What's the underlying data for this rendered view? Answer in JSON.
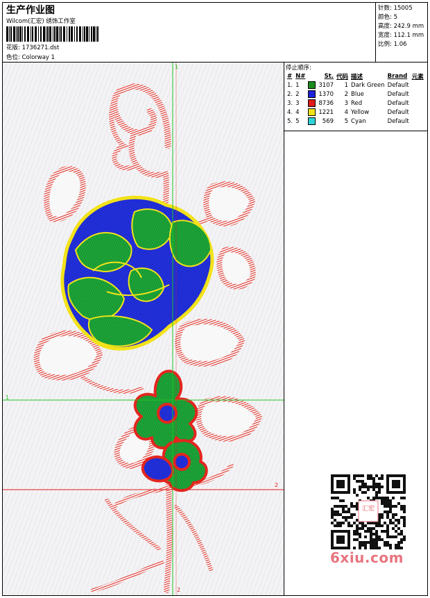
{
  "header": {
    "title": "生产作业图",
    "subtitle": "Wilcom(汇宏) 绣饰工作室",
    "design_label": "花版:",
    "design_value": "1736271.dst",
    "colorway_label": "色位:",
    "colorway_value": "Colorway 1"
  },
  "stats": [
    {
      "label": "针数:",
      "value": "15005"
    },
    {
      "label": "颜色:",
      "value": "5"
    },
    {
      "label": "高度:",
      "value": "242.9 mm"
    },
    {
      "label": "宽度:",
      "value": "112.1 mm"
    },
    {
      "label": "比例:",
      "value": "1.06"
    }
  ],
  "sequence": {
    "title": "停止顺序:",
    "columns": [
      "#",
      "N#",
      "St.",
      "代码",
      "描述",
      "Brand",
      "元素"
    ],
    "rows": [
      {
        "n": "1.",
        "k": "1",
        "color": "#1a8c1a",
        "st": "3107",
        "code": "1",
        "desc": "Dark Green",
        "brand": "Default"
      },
      {
        "n": "2.",
        "k": "2",
        "color": "#1e22d8",
        "st": "1370",
        "code": "2",
        "desc": "Blue",
        "brand": "Default"
      },
      {
        "n": "3.",
        "k": "3",
        "color": "#e01b1b",
        "st": "8736",
        "code": "3",
        "desc": "Red",
        "brand": "Default"
      },
      {
        "n": "4.",
        "k": "4",
        "color": "#f2e21a",
        "st": "1221",
        "code": "4",
        "desc": "Yellow",
        "brand": "Default"
      },
      {
        "n": "5.",
        "k": "5",
        "color": "#2fd4d8",
        "st": "569",
        "code": "5",
        "desc": "Cyan",
        "brand": "Default"
      }
    ]
  },
  "guides": {
    "v1": "1",
    "h1": "1",
    "h2": "2",
    "v2": "2"
  },
  "colors": {
    "green_guide": "#22c422",
    "red_guide": "#e01b1b",
    "red_stitch": "#e3261e",
    "blue_stitch": "#1e2ad8",
    "green_stitch": "#179a2a",
    "yellow_stitch": "#f2e21a"
  },
  "watermark": {
    "text": "6xiu.com",
    "seal": "汇宏"
  }
}
